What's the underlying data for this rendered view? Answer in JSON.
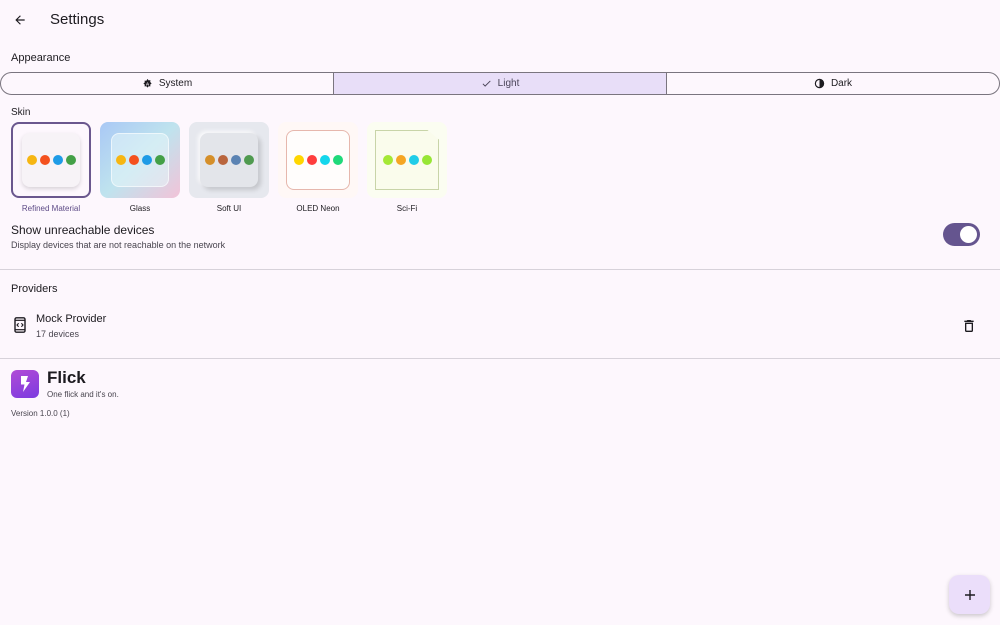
{
  "header": {
    "title": "Settings",
    "back_icon": "arrow-left-icon"
  },
  "appearance": {
    "label": "Appearance",
    "options": [
      {
        "label": "System",
        "icon": "auto-mode-icon",
        "selected": false
      },
      {
        "label": "Light",
        "icon": "check-icon",
        "selected": true
      },
      {
        "label": "Dark",
        "icon": "moon-icon",
        "selected": false
      }
    ]
  },
  "skin": {
    "label": "Skin",
    "items": [
      {
        "label": "Refined Material",
        "selected": true,
        "dots": [
          "#f6b612",
          "#f4511e",
          "#1e9be6",
          "#43a047"
        ]
      },
      {
        "label": "Glass",
        "selected": false,
        "dots": [
          "#f6b612",
          "#f4511e",
          "#1e9be6",
          "#43a047"
        ]
      },
      {
        "label": "Soft UI",
        "selected": false,
        "dots": [
          "#d58f2a",
          "#b9653d",
          "#5b83b3",
          "#4f9a4f"
        ]
      },
      {
        "label": "OLED Neon",
        "selected": false,
        "dots": [
          "#ffd600",
          "#ff3d3d",
          "#14d6ec",
          "#1fd97a"
        ]
      },
      {
        "label": "Sci-Fi",
        "selected": false,
        "dots": [
          "#a4e835",
          "#f5a623",
          "#20cde8",
          "#97e635"
        ]
      }
    ]
  },
  "unreachable": {
    "title": "Show unreachable devices",
    "subtitle": "Display devices that are not reachable on the network",
    "enabled": true
  },
  "providers": {
    "label": "Providers",
    "items": [
      {
        "name": "Mock Provider",
        "count": "17 devices",
        "icon": "mock-device-icon",
        "action_icon": "trash-icon"
      }
    ]
  },
  "about": {
    "app_name": "Flick",
    "tagline": "One flick and it's on.",
    "version": "Version 1.0.0 (1)",
    "logo_icon": "lightning-bolt-icon"
  },
  "fab": {
    "icon": "plus-icon"
  },
  "colors": {
    "accent": "#65558f",
    "selected_segment": "#e8def8",
    "background": "#fdf7fd"
  }
}
